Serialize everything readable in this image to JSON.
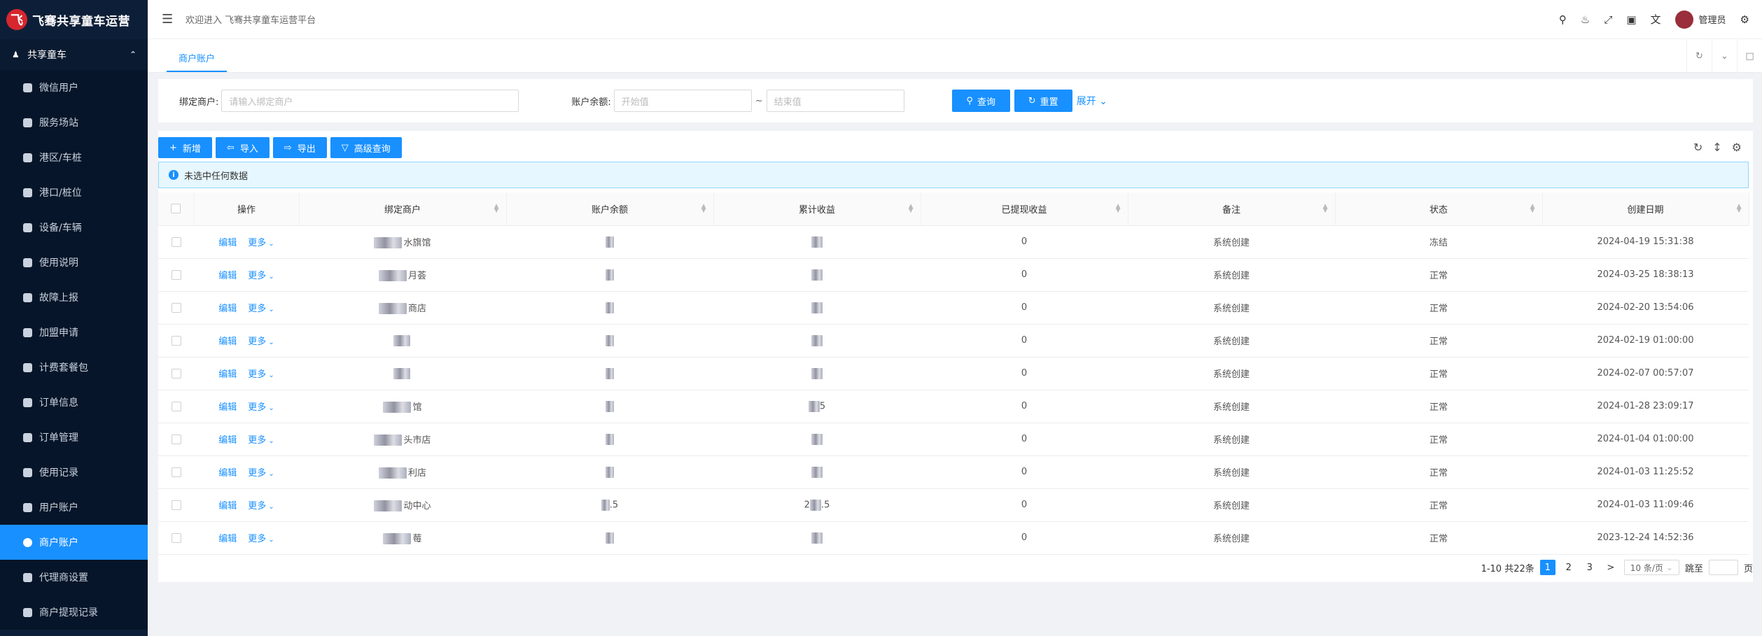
{
  "app": {
    "logo_letter": "飞",
    "title": "飞骞共享童车运营"
  },
  "sidebar": {
    "group": {
      "label": "共享童车"
    },
    "items": [
      {
        "label": "微信用户"
      },
      {
        "label": "服务场站"
      },
      {
        "label": "港区/车桩"
      },
      {
        "label": "港口/桩位"
      },
      {
        "label": "设备/车辆"
      },
      {
        "label": "使用说明"
      },
      {
        "label": "故障上报"
      },
      {
        "label": "加盟申请"
      },
      {
        "label": "计费套餐包"
      },
      {
        "label": "订单信息"
      },
      {
        "label": "订单管理"
      },
      {
        "label": "使用记录"
      },
      {
        "label": "用户账户"
      },
      {
        "label": "商户账户",
        "active": true
      },
      {
        "label": "代理商设置"
      },
      {
        "label": "商户提现记录"
      }
    ]
  },
  "header": {
    "welcome": "欢迎进入 飞骞共享童车运营平台",
    "admin": "管理员"
  },
  "tabs": [
    {
      "label": "商户账户"
    }
  ],
  "search": {
    "merchant_label": "绑定商户:",
    "merchant_placeholder": "请输入绑定商户",
    "balance_label": "账户余额:",
    "start_placeholder": "开始值",
    "tilde": "~",
    "end_placeholder": "结束值",
    "query_label": "查询",
    "reset_label": "重置",
    "expand_label": "展开"
  },
  "toolbar": {
    "add_label": "新增",
    "import_label": "导入",
    "export_label": "导出",
    "advanced_label": "高级查询"
  },
  "alert": {
    "text": "未选中任何数据"
  },
  "table": {
    "columns": [
      "操作",
      "绑定商户",
      "账户余额",
      "累计收益",
      "已提现收益",
      "备注",
      "状态",
      "创建日期"
    ],
    "edit_label": "编辑",
    "more_label": "更多",
    "rows": [
      {
        "merchant": "水旗馆",
        "withdrawn": "0",
        "note": "系统创建",
        "status": "冻结",
        "created": "2024-04-19 15:31:38"
      },
      {
        "merchant": "月荟",
        "withdrawn": "0",
        "note": "系统创建",
        "status": "正常",
        "created": "2024-03-25 18:38:13"
      },
      {
        "merchant": "商店",
        "withdrawn": "0",
        "note": "系统创建",
        "status": "正常",
        "created": "2024-02-20 13:54:06"
      },
      {
        "merchant": "",
        "withdrawn": "0",
        "note": "系统创建",
        "status": "正常",
        "created": "2024-02-19 01:00:00"
      },
      {
        "merchant": "",
        "withdrawn": "0",
        "note": "系统创建",
        "status": "正常",
        "created": "2024-02-07 00:57:07"
      },
      {
        "merchant": "馆",
        "earn_suffix": "5",
        "withdrawn": "0",
        "note": "系统创建",
        "status": "正常",
        "created": "2024-01-28 23:09:17"
      },
      {
        "merchant": "头市店",
        "withdrawn": "0",
        "note": "系统创建",
        "status": "正常",
        "created": "2024-01-04 01:00:00"
      },
      {
        "merchant": "利店",
        "withdrawn": "0",
        "note": "系统创建",
        "status": "正常",
        "created": "2024-01-03 11:25:52"
      },
      {
        "merchant": "动中心",
        "bal_suffix": ".5",
        "earn_prefix": "2",
        "earn_suffix": ".5",
        "withdrawn": "0",
        "note": "系统创建",
        "status": "正常",
        "created": "2024-01-03 11:09:46"
      },
      {
        "merchant": "莓",
        "withdrawn": "0",
        "note": "系统创建",
        "status": "正常",
        "created": "2023-12-24 14:52:36"
      }
    ]
  },
  "pager": {
    "summary": "1-10 共22条",
    "pages": [
      "1",
      "2",
      "3"
    ],
    "current": "1",
    "next": ">",
    "size": "10 条/页",
    "jump_label": "跳至",
    "page_unit": "页"
  },
  "colors": {
    "primary": "#1890ff",
    "sidebar_bg": "#0d1f38",
    "alert_bg": "#e6f7ff"
  }
}
